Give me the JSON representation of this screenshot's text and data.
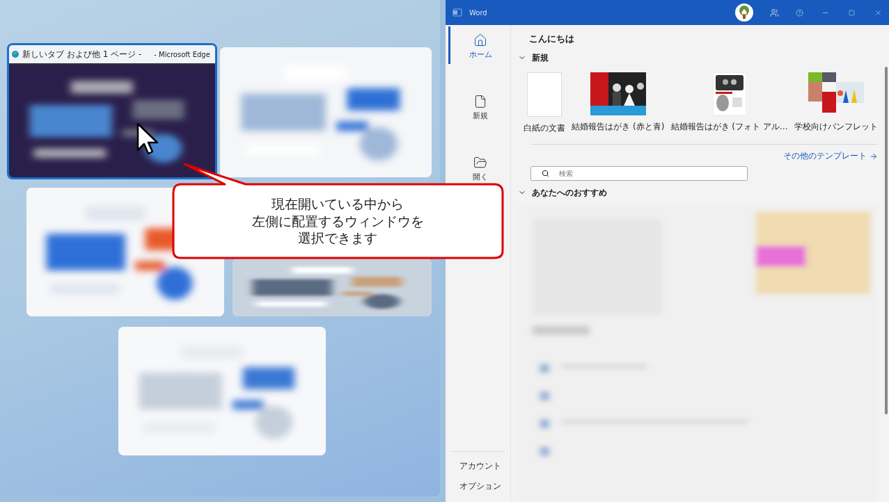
{
  "snap_assist": {
    "windows": [
      {
        "kind": "app",
        "title": "新しいタブ および他 1 ページ -",
        "app": "- Microsoft Edge",
        "selected": true
      },
      {
        "kind": "picture",
        "selected": false
      },
      {
        "kind": "picture",
        "selected": false
      },
      {
        "kind": "picture",
        "selected": false
      },
      {
        "kind": "picture",
        "selected": false
      }
    ]
  },
  "word": {
    "title": "Word",
    "nav": [
      {
        "label": "ホーム",
        "selected": true,
        "kind": "home"
      },
      {
        "label": "新規",
        "selected": false,
        "kind": "new"
      },
      {
        "label": "開く",
        "selected": false,
        "kind": "open"
      }
    ],
    "nav_footer": [
      "アカウント",
      "オプション"
    ],
    "greeting": "こんにちは",
    "new_section": {
      "heading": "新規",
      "expanded": true,
      "templates": [
        {
          "label": "白紙の文書",
          "kind": "blank"
        },
        {
          "label": "結婚報告はがき (赤と青)",
          "kind": "picture"
        },
        {
          "label": "結婚報告はがき (フォト アル…",
          "kind": "picture"
        },
        {
          "label": "学校向けパンフレット",
          "kind": "picture"
        }
      ]
    },
    "more_templates": "その他のテンプレート",
    "search": {
      "placeholder": "検索"
    },
    "recommended": {
      "heading": "あなたへのおすすめ",
      "expanded": true
    }
  },
  "callout": {
    "lines": [
      "現在開いている中から",
      "左側に配置するウィンドウを",
      "選択できます"
    ]
  }
}
